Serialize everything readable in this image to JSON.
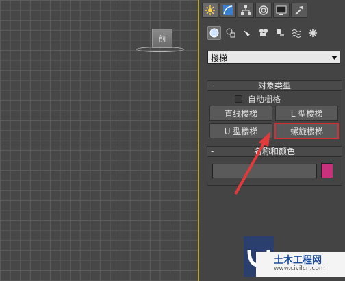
{
  "viewport": {
    "viewcube_label": "前"
  },
  "command_panel": {
    "tabs": [
      {
        "name": "create-tab-icon",
        "active": true
      },
      {
        "name": "modify-tab-icon",
        "active": false
      },
      {
        "name": "hierarchy-tab-icon",
        "active": false
      },
      {
        "name": "motion-tab-icon",
        "active": false
      },
      {
        "name": "display-tab-icon",
        "active": false
      },
      {
        "name": "utilities-tab-icon",
        "active": false
      }
    ],
    "categories": [
      {
        "name": "geometry-icon",
        "active": true
      },
      {
        "name": "shapes-icon",
        "active": false
      },
      {
        "name": "lights-icon",
        "active": false
      },
      {
        "name": "cameras-icon",
        "active": false
      },
      {
        "name": "helpers-icon",
        "active": false
      },
      {
        "name": "spacewarps-icon",
        "active": false
      },
      {
        "name": "systems-icon",
        "active": false
      }
    ],
    "subcategory": {
      "value": "楼梯"
    },
    "object_type": {
      "title": "对象类型",
      "collapse": "-",
      "auto_grid_label": "自动栅格",
      "buttons": {
        "straight": "直线楼梯",
        "l_type": "L 型楼梯",
        "u_type": "U 型楼梯",
        "spiral": "螺旋楼梯"
      }
    },
    "name_and_color": {
      "title": "名称和颜色",
      "collapse": "-",
      "name_value": "",
      "color": "#c8327d"
    }
  },
  "watermark": {
    "title": "土木工程网",
    "url": "www.civilcn.com"
  },
  "colors": {
    "highlight": "#d03030",
    "arrow": "#e03a3a",
    "viewport_border": "#b8a33a"
  }
}
